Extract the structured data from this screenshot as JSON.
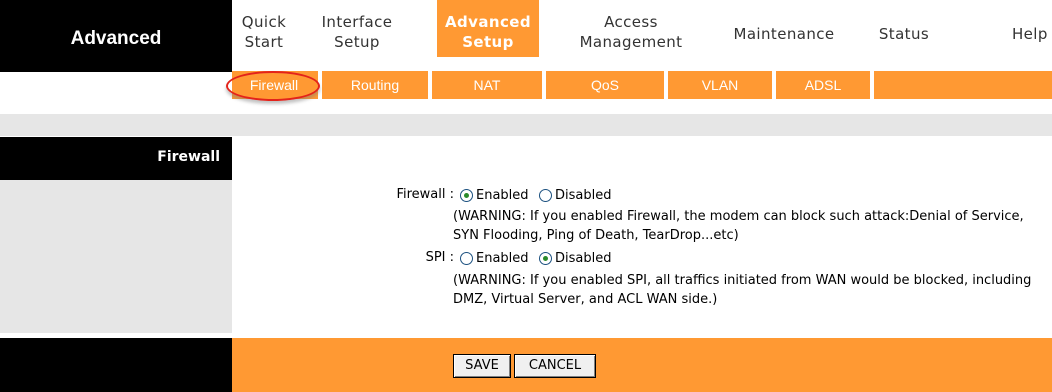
{
  "brand": {
    "label": "Advanced"
  },
  "menu": {
    "items": [
      {
        "line1": "Quick",
        "line2": "Start"
      },
      {
        "line1": "Interface",
        "line2": "Setup"
      },
      {
        "line1": "Advanced",
        "line2": "Setup"
      },
      {
        "line1": "Access",
        "line2": "Management"
      },
      {
        "line1": "Maintenance",
        "line2": ""
      },
      {
        "line1": "Status",
        "line2": ""
      },
      {
        "line1": "Help",
        "line2": ""
      }
    ],
    "active_index": 2,
    "active_color": "#ff9933"
  },
  "submenu": {
    "items": [
      "Firewall",
      "Routing",
      "NAT",
      "QoS",
      "VLAN",
      "ADSL"
    ],
    "active": "Firewall",
    "highlight_color": "#e3231b"
  },
  "section": {
    "title": "Firewall"
  },
  "form": {
    "firewall": {
      "label": "Firewall :",
      "options": [
        "Enabled",
        "Disabled"
      ],
      "selected": "Enabled",
      "warning_line1": "(WARNING: If you enabled Firewall, the modem can block such attack:Denial of Service,",
      "warning_line2": "SYN Flooding, Ping of Death, TearDrop...etc)"
    },
    "spi": {
      "label": "SPI :",
      "options": [
        "Enabled",
        "Disabled"
      ],
      "selected": "Disabled",
      "warning_line1": "(WARNING: If you enabled SPI, all traffics initiated from WAN would be blocked, including",
      "warning_line2": "DMZ, Virtual Server, and ACL WAN side.)"
    }
  },
  "buttons": {
    "save": "SAVE",
    "cancel": "CANCEL"
  },
  "colors": {
    "accent": "#ff9933",
    "dark": "#000000",
    "panel": "#e6e6e6"
  }
}
